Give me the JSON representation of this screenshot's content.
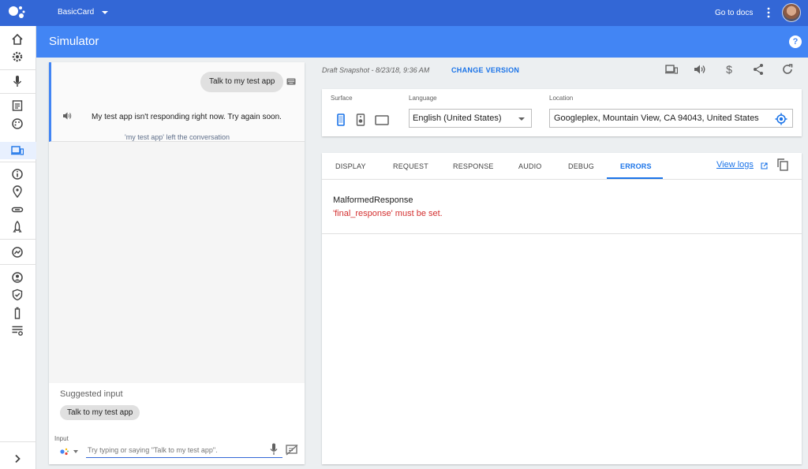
{
  "topbar": {
    "project_name": "BasicCard",
    "go_to_docs": "Go to docs",
    "colors": {
      "background": "#3367d6"
    }
  },
  "rail": {
    "items": [
      {
        "icon": "home-icon"
      },
      {
        "icon": "gear-icon"
      },
      {
        "icon": "mic-icon"
      },
      {
        "icon": "document-icon"
      },
      {
        "icon": "palette-icon"
      },
      {
        "icon": "devices-icon",
        "selected": true
      },
      {
        "icon": "info-icon"
      },
      {
        "icon": "location-pin-icon"
      },
      {
        "icon": "link-icon"
      },
      {
        "icon": "rocket-icon"
      },
      {
        "icon": "analytics-icon"
      },
      {
        "icon": "account-icon"
      },
      {
        "icon": "shield-icon"
      },
      {
        "icon": "battery-icon"
      },
      {
        "icon": "settings-list-icon"
      },
      {
        "icon": "expand-chevron-icon"
      }
    ]
  },
  "simulator": {
    "title": "Simulator",
    "help": "?",
    "colors": {
      "header": "#4285f4"
    }
  },
  "chat": {
    "user_message": "Talk to my test app",
    "bot_message": "My test app isn't responding right now. Try again soon.",
    "left_conversation": "'my test app' left the conversation",
    "suggested_label": "Suggested input",
    "suggestion_chip": "Talk to my test app",
    "input_label": "Input",
    "input_placeholder": "Try typing or saying \"Talk to my test app\"."
  },
  "toolbar": {
    "draft_snapshot": "Draft Snapshot - 8/23/18, 9:36 AM",
    "change_version": "CHANGE VERSION",
    "icons": [
      "devices-icon",
      "volume-icon",
      "dollar-icon",
      "share-icon",
      "refresh-icon"
    ]
  },
  "settings": {
    "surface_label": "Surface",
    "language_label": "Language",
    "language_value": "English (United States)",
    "location_label": "Location",
    "location_value": "Googleplex, Mountain View, CA 94043, United States"
  },
  "result": {
    "tabs": [
      "DISPLAY",
      "REQUEST",
      "RESPONSE",
      "AUDIO",
      "DEBUG",
      "ERRORS"
    ],
    "active_tab": "ERRORS",
    "view_logs": "View logs",
    "error_title": "MalformedResponse",
    "error_message": "'final_response' must be set.",
    "colors": {
      "accent": "#1a73e8",
      "error": "#d32f2f"
    }
  }
}
